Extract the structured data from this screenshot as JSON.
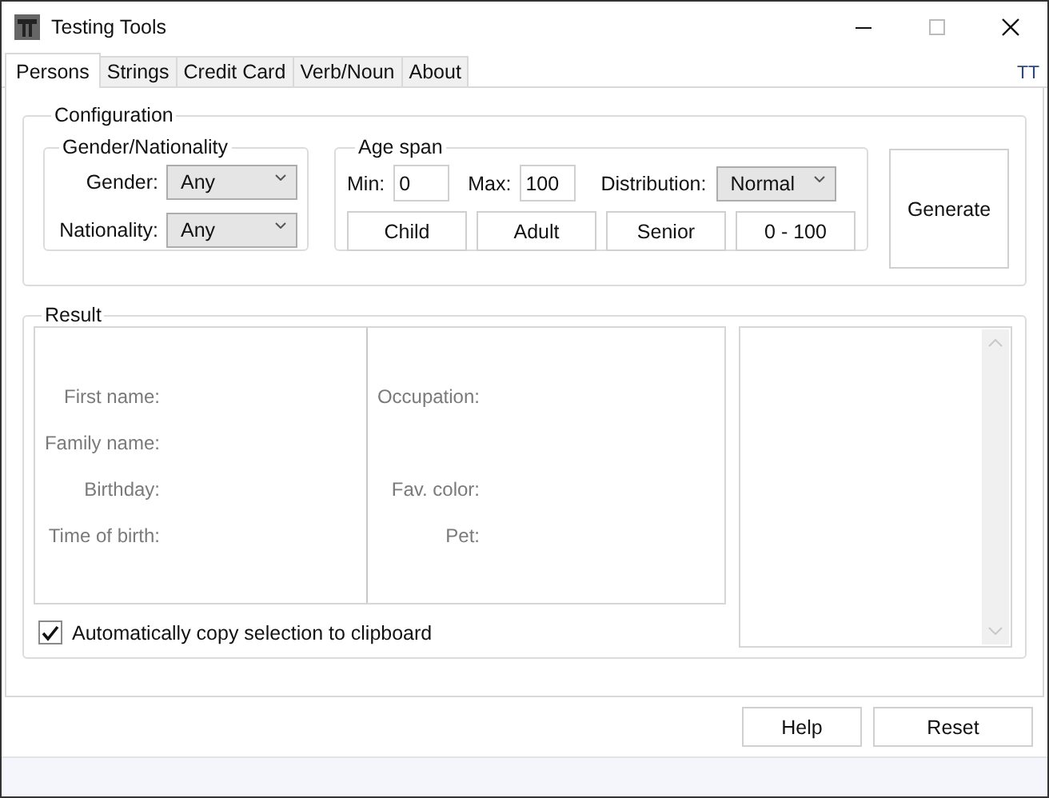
{
  "window": {
    "title": "Testing Tools"
  },
  "tabs": [
    {
      "label": "Persons",
      "selected": true
    },
    {
      "label": "Strings",
      "selected": false
    },
    {
      "label": "Credit Card",
      "selected": false
    },
    {
      "label": "Verb/Noun",
      "selected": false
    },
    {
      "label": "About",
      "selected": false
    }
  ],
  "tab_strip_badge": "TT",
  "configuration": {
    "title": "Configuration",
    "gender_nationality": {
      "title": "Gender/Nationality",
      "fields": [
        {
          "label": "Gender:",
          "value": "Any"
        },
        {
          "label": "Nationality:",
          "value": "Any"
        }
      ]
    },
    "age_span": {
      "title": "Age span",
      "min": {
        "label": "Min:",
        "value": "0"
      },
      "max": {
        "label": "Max:",
        "value": "100"
      },
      "distribution": {
        "label": "Distribution:",
        "value": "Normal"
      },
      "presets": [
        "Child",
        "Adult",
        "Senior",
        "0 - 100"
      ]
    },
    "generate_button": "Generate"
  },
  "result": {
    "title": "Result",
    "rows": [
      {
        "left": "First name:",
        "right": "Occupation:"
      },
      {
        "left": "Family name:"
      },
      {
        "left": "Birthday:",
        "right": "Fav. color:"
      },
      {
        "left": "Time of birth:",
        "right": "Pet:"
      }
    ],
    "auto_copy": {
      "label": "Automatically copy selection to clipboard",
      "checked": true
    }
  },
  "buttons": [
    "Help",
    "Reset"
  ]
}
